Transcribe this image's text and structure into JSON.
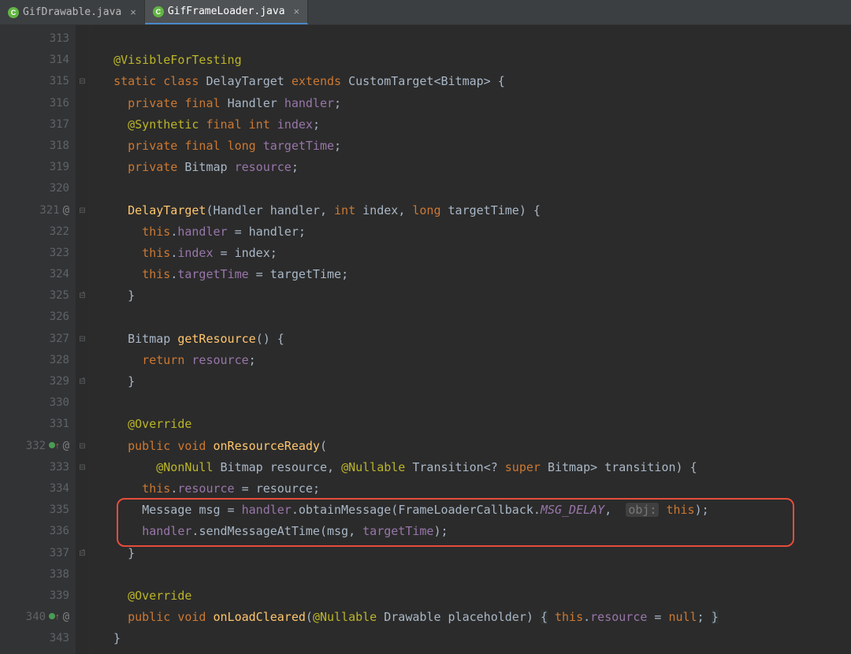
{
  "tabs": [
    {
      "label": "GifDrawable.java",
      "active": false
    },
    {
      "label": "GifFrameLoader.java",
      "active": true
    }
  ],
  "gutter": {
    "lines": [
      {
        "n": "313"
      },
      {
        "n": "314"
      },
      {
        "n": "315"
      },
      {
        "n": "316"
      },
      {
        "n": "317"
      },
      {
        "n": "318"
      },
      {
        "n": "319"
      },
      {
        "n": "320"
      },
      {
        "n": "321",
        "marks": [
          "at"
        ]
      },
      {
        "n": "322"
      },
      {
        "n": "323"
      },
      {
        "n": "324"
      },
      {
        "n": "325"
      },
      {
        "n": "326"
      },
      {
        "n": "327"
      },
      {
        "n": "328"
      },
      {
        "n": "329"
      },
      {
        "n": "330"
      },
      {
        "n": "331"
      },
      {
        "n": "332",
        "marks": [
          "impl",
          "at"
        ]
      },
      {
        "n": "333"
      },
      {
        "n": "334"
      },
      {
        "n": "335"
      },
      {
        "n": "336"
      },
      {
        "n": "337"
      },
      {
        "n": "338"
      },
      {
        "n": "339"
      },
      {
        "n": "340",
        "marks": [
          "impl",
          "at"
        ]
      },
      {
        "n": "343"
      }
    ]
  },
  "fold": [
    "",
    "",
    "⊟",
    "",
    "",
    "",
    "",
    "",
    "⊟",
    "",
    "",
    "",
    "⊟̂",
    "",
    "⊟",
    "",
    "⊟̂",
    "",
    "",
    "⊟",
    "⊟",
    "",
    "",
    "",
    "⊟̂",
    "",
    "",
    "",
    ""
  ],
  "code": {
    "l313": "",
    "l314": "@VisibleForTesting",
    "l315_kw1": "static",
    "l315_kw2": "class",
    "l315_name": "DelayTarget",
    "l315_kw3": "extends",
    "l315_super": "CustomTarget",
    "l315_gen": "<Bitmap>",
    "l316_kw1": "private",
    "l316_kw2": "final",
    "l316_type": "Handler",
    "l316_field": "handler",
    "l317_ann": "@Synthetic",
    "l317_kw": "final",
    "l317_int": "int",
    "l317_field": "index",
    "l318_kw1": "private",
    "l318_kw2": "final",
    "l318_long": "long",
    "l318_field": "targetTime",
    "l319_kw": "private",
    "l319_type": "Bitmap",
    "l319_field": "resource",
    "l321_name": "DelayTarget",
    "l321_p1t": "Handler",
    "l321_p1": "handler",
    "l321_int": "int",
    "l321_p2": "index",
    "l321_long": "long",
    "l321_p3": "targetTime",
    "l322_this": "this",
    "l322_field": "handler",
    "l322_rhs": "handler",
    "l323_this": "this",
    "l323_field": "index",
    "l323_rhs": "index",
    "l324_this": "this",
    "l324_field": "targetTime",
    "l324_rhs": "targetTime",
    "l327_type": "Bitmap",
    "l327_name": "getResource",
    "l328_kw": "return",
    "l328_field": "resource",
    "l331": "@Override",
    "l332_kw1": "public",
    "l332_void": "void",
    "l332_name": "onResourceReady",
    "l333_ann1": "@NonNull",
    "l333_t1": "Bitmap",
    "l333_p1": "resource",
    "l333_ann2": "@Nullable",
    "l333_t2": "Transition",
    "l333_gen": "<?",
    "l333_super": "super",
    "l333_t3": "Bitmap>",
    "l333_p2": "transition",
    "l334_this": "this",
    "l334_field": "resource",
    "l334_rhs": "resource",
    "l335_type": "Message",
    "l335_var": "msg",
    "l335_h": "handler",
    "l335_m": "obtainMessage",
    "l335_cls": "FrameLoaderCallback",
    "l335_const": "MSG_DELAY",
    "l335_hint": "obj:",
    "l335_this": "this",
    "l336_h": "handler",
    "l336_m": "sendMessageAtTime",
    "l336_a1": "msg",
    "l336_a2": "targetTime",
    "l339": "@Override",
    "l340_kw1": "public",
    "l340_void": "void",
    "l340_name": "onLoadCleared",
    "l340_ann": "@Nullable",
    "l340_t": "Drawable",
    "l340_p": "placeholder",
    "l340_this": "this",
    "l340_field": "resource",
    "l340_null": "null"
  }
}
